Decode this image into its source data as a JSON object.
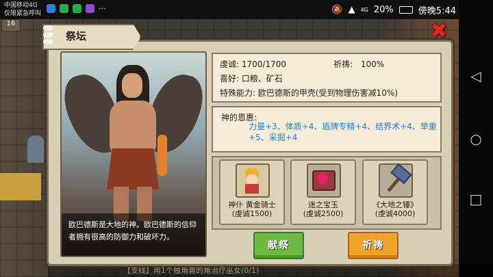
{
  "status_bar": {
    "carrier_line1": "中国移动4G",
    "carrier_line2": "仅限紧急呼叫",
    "more": "···",
    "network": "4G",
    "battery": "20%",
    "time": "傍晚5:44"
  },
  "hud": {
    "level": "16"
  },
  "dialog": {
    "title": "祭坛",
    "close_icon": "close-x-icon"
  },
  "portrait": {
    "caption": "欧巴德斯是大地的神。欧巴德斯的信仰者拥有很高的防御力和破坏力。"
  },
  "info": {
    "piety_label": "虔诚:",
    "piety_value": "1700/1700",
    "prayer_label": "祈祷:",
    "prayer_value": "100%",
    "likes_label": "喜好:",
    "likes_value": "口粮、矿石",
    "ability_label": "特殊能力:",
    "ability_value": "欧巴德斯的甲壳(受到物理伤害减10%)"
  },
  "blessing": {
    "title": "神的恩惠:",
    "text": "力量+3、体质+4、盾牌专精+4、结界术+4、举重+5、采掘+4"
  },
  "items": [
    {
      "name": "神仆 黄金骑士",
      "cost": "(虔诚1500)",
      "icon": "golden-knight-icon"
    },
    {
      "name": "迷之宝玉",
      "cost": "(虔诚2500)",
      "icon": "red-gem-icon"
    },
    {
      "name": "《大地之锤》",
      "cost": "(虔诚4000)",
      "icon": "hammer-icon"
    }
  ],
  "buttons": {
    "offer": "献祭",
    "pray": "祈祷"
  },
  "bottom_text": "【支线】用1个独角兽的角治疗巫女(0/1)",
  "colors": {
    "offer": "#6db843",
    "pray": "#f0a22a",
    "close": "#e32424",
    "blessing_text": "#2a7fd6"
  }
}
